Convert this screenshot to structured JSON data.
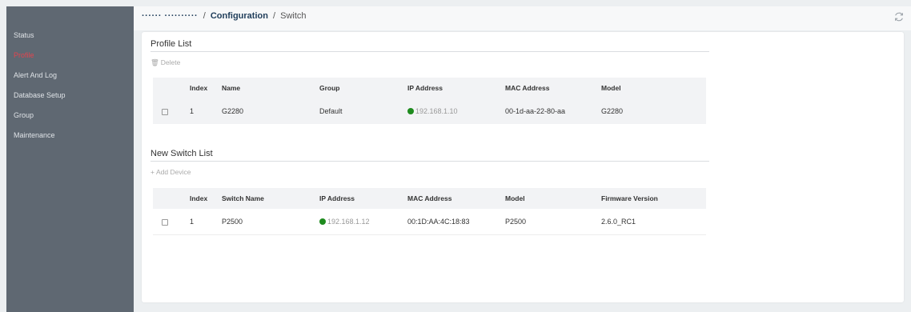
{
  "sidebar": {
    "items": [
      {
        "label": "Status"
      },
      {
        "label": "Profile"
      },
      {
        "label": "Alert And Log"
      },
      {
        "label": "Database Setup"
      },
      {
        "label": "Group"
      },
      {
        "label": "Maintenance"
      }
    ]
  },
  "header": {
    "breadcrumb_hidden": "······  ·········· ",
    "breadcrumb_sep": "/",
    "breadcrumb_section": "Configuration",
    "breadcrumb_page": "Switch"
  },
  "profile_list": {
    "title": "Profile List",
    "delete_label": "Delete",
    "columns": [
      "Index",
      "Name",
      "Group",
      "IP Address",
      "MAC Address",
      "Model"
    ],
    "rows": [
      {
        "index": "1",
        "name": "G2280",
        "group": "Default",
        "ip": "192.168.1.10",
        "mac": "00-1d-aa-22-80-aa",
        "model": "G2280"
      }
    ]
  },
  "new_switch_list": {
    "title": "New Switch List",
    "add_label": "Add Device",
    "columns": [
      "Index",
      "Switch Name",
      "IP Address",
      "MAC Address",
      "Model",
      "Firmware Version"
    ],
    "rows": [
      {
        "index": "1",
        "name": "P2500",
        "ip": "192.168.1.12",
        "mac": "00:1D:AA:4C:18:83",
        "model": "P2500",
        "firmware": "2.6.0_RC1"
      }
    ]
  },
  "colors": {
    "sidebar_bg": "#5f6872",
    "active_item": "#e2454f",
    "status_online": "#1e8b1e"
  },
  "icons": {
    "refresh": "refresh-icon",
    "delete": "trash-icon",
    "add": "plus-icon",
    "status": "online-dot-icon"
  }
}
